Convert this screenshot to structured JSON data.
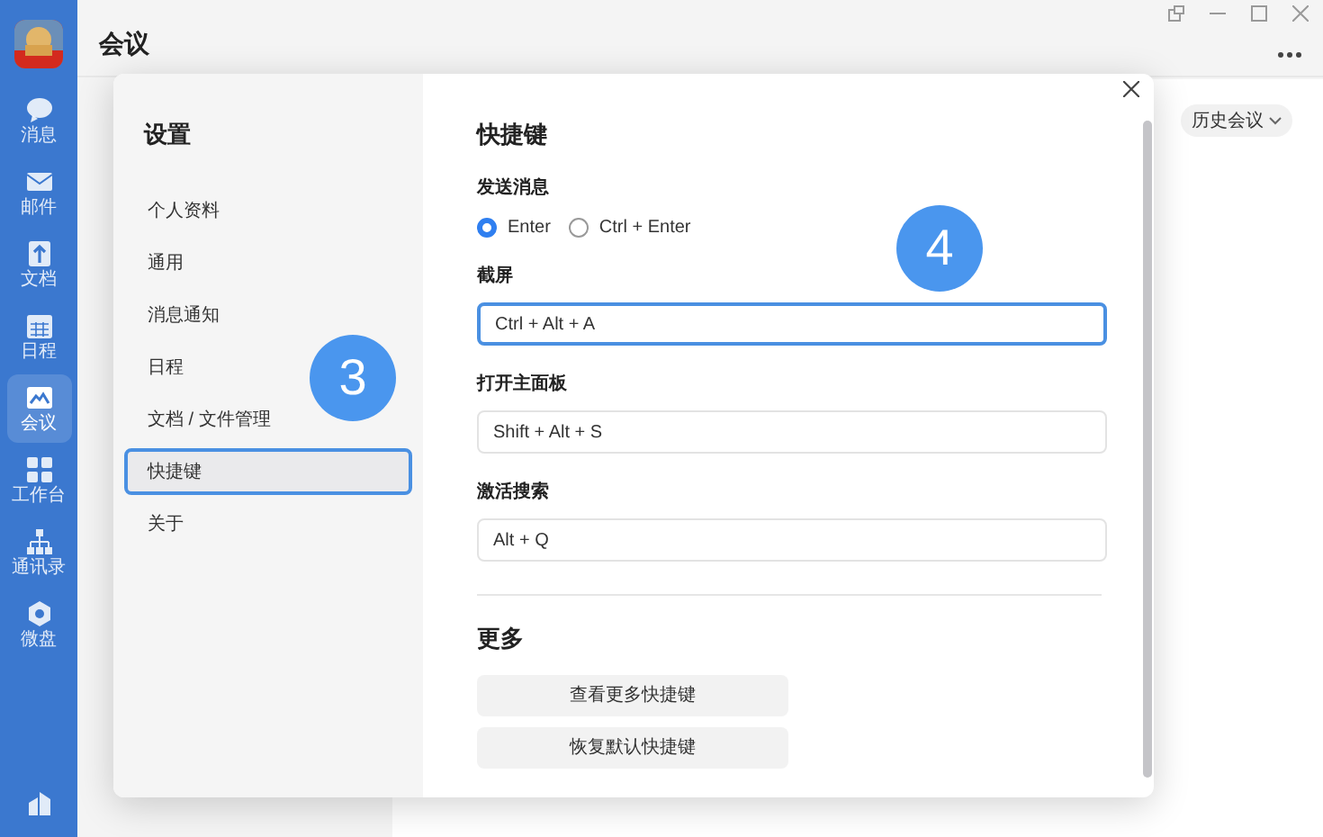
{
  "app_nav": [
    {
      "label": "消息",
      "kind": "chat",
      "selected": false
    },
    {
      "label": "邮件",
      "kind": "mail",
      "selected": false
    },
    {
      "label": "文档",
      "kind": "doc",
      "selected": false
    },
    {
      "label": "日程",
      "kind": "calendar",
      "selected": false
    },
    {
      "label": "会议",
      "kind": "meeting",
      "selected": true
    },
    {
      "label": "工作台",
      "kind": "grid",
      "selected": false
    },
    {
      "label": "通讯录",
      "kind": "org",
      "selected": false
    },
    {
      "label": "微盘",
      "kind": "disk",
      "selected": false
    }
  ],
  "page": {
    "title": "会议",
    "history_button": "历史会议"
  },
  "settings": {
    "title": "设置",
    "menu": [
      {
        "label": "个人资料",
        "selected": false
      },
      {
        "label": "通用",
        "selected": false
      },
      {
        "label": "消息通知",
        "selected": false
      },
      {
        "label": "日程",
        "selected": false
      },
      {
        "label": "文档 / 文件管理",
        "selected": false
      },
      {
        "label": "快捷键",
        "selected": true
      },
      {
        "label": "关于",
        "selected": false
      }
    ],
    "heading": "快捷键",
    "send_message": {
      "label": "发送消息",
      "options": [
        {
          "label": "Enter",
          "selected": true
        },
        {
          "label": "Ctrl + Enter",
          "selected": false
        }
      ]
    },
    "shortcuts": [
      {
        "label": "截屏",
        "value": "Ctrl + Alt + A",
        "focused": true
      },
      {
        "label": "打开主面板",
        "value": "Shift + Alt + S",
        "focused": false
      },
      {
        "label": "激活搜索",
        "value": "Alt + Q",
        "focused": false
      }
    ],
    "more": {
      "title": "更多",
      "buttons": [
        "查看更多快捷键",
        "恢复默认快捷键"
      ]
    }
  },
  "annotations": [
    {
      "label": "3"
    },
    {
      "label": "4"
    }
  ]
}
